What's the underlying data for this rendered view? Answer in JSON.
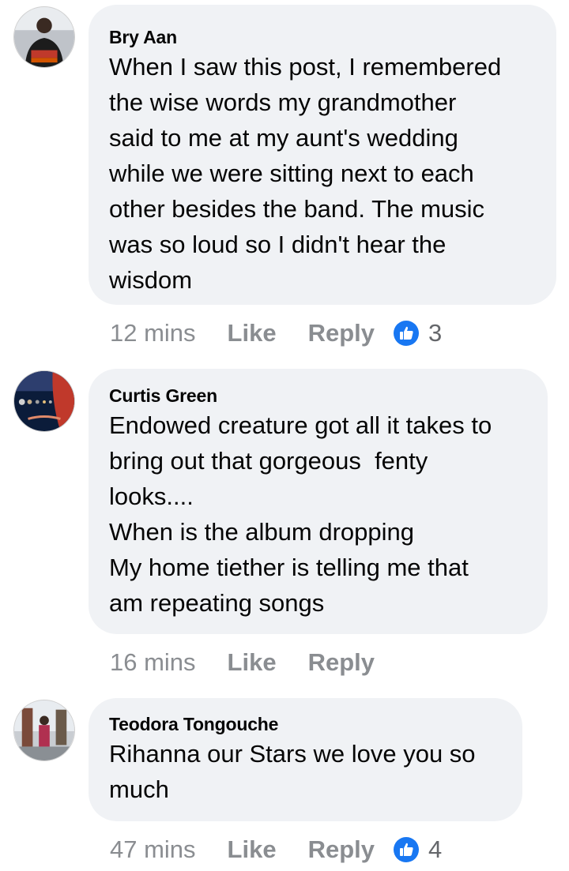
{
  "comments": [
    {
      "author": "Bry Aan",
      "text": "When I saw this post, I remembered\nthe wise words my grandmother\nsaid to me at my aunt's wedding\nwhile we were sitting next to each\nother besides the band. The music\nwas so loud so I didn't hear the\nwisdom",
      "time": "12 mins",
      "like_label": "Like",
      "reply_label": "Reply",
      "reaction_icon": "like-thumbs-up-icon",
      "reaction_count": "3"
    },
    {
      "author": "Curtis Green",
      "text": "Endowed creature got all it takes to\nbring out that gorgeous  fenty\nlooks....\nWhen is the album dropping\nMy home tiether is telling me that\nam repeating songs",
      "time": "16 mins",
      "like_label": "Like",
      "reply_label": "Reply"
    },
    {
      "author": "Teodora Tongouche",
      "text": "Rihanna our Stars we love you so\nmuch",
      "time": "47 mins",
      "like_label": "Like",
      "reply_label": "Reply",
      "reaction_icon": "like-thumbs-up-icon",
      "reaction_count": "4"
    }
  ],
  "colors": {
    "bubble": "#f0f2f5",
    "meta_text": "#8a8d91",
    "like_blue": "#1877f2"
  }
}
